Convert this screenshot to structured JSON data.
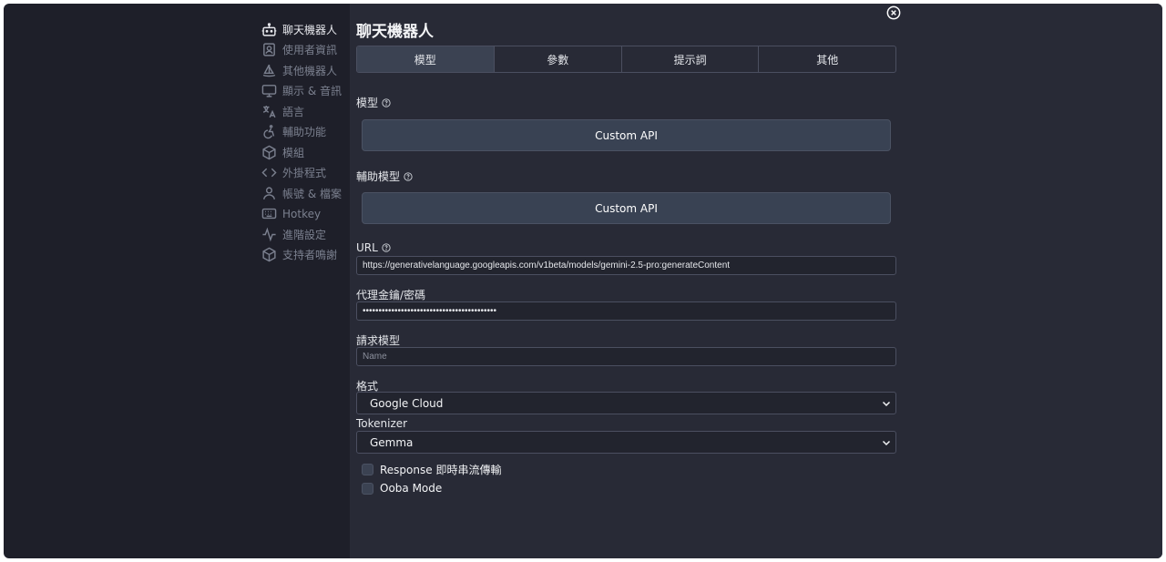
{
  "sidebar": {
    "items": [
      {
        "label": "聊天機器人",
        "icon": "bot-icon",
        "active": true
      },
      {
        "label": "使用者資訊",
        "icon": "user-card-icon"
      },
      {
        "label": "其他機器人",
        "icon": "sailboat-icon"
      },
      {
        "label": "顯示 & 音訊",
        "icon": "monitor-icon"
      },
      {
        "label": "語言",
        "icon": "translate-icon"
      },
      {
        "label": "輔助功能",
        "icon": "accessibility-icon"
      },
      {
        "label": "模組",
        "icon": "box-icon"
      },
      {
        "label": "外掛程式",
        "icon": "code-icon"
      },
      {
        "label": "帳號 & 檔案",
        "icon": "user-icon"
      },
      {
        "label": "Hotkey",
        "icon": "keyboard-icon"
      },
      {
        "label": "進階設定",
        "icon": "activity-icon"
      },
      {
        "label": "支持者鳴謝",
        "icon": "package-icon"
      }
    ]
  },
  "page": {
    "title": "聊天機器人"
  },
  "tabs": [
    "模型",
    "參數",
    "提示詞",
    "其他"
  ],
  "model": {
    "label": "模型",
    "value": "Custom API"
  },
  "aux_model": {
    "label": "輔助模型",
    "value": "Custom API"
  },
  "url": {
    "label": "URL",
    "value": "https://generativelanguage.googleapis.com/v1beta/models/gemini-2.5-pro:generateContent"
  },
  "proxy_key": {
    "label": "代理金鑰/密碼",
    "value": "••••••••••••••••••••••••••••••••••••••••••"
  },
  "request_model": {
    "label": "請求模型",
    "placeholder": "Name"
  },
  "format": {
    "label": "格式",
    "value": "Google Cloud"
  },
  "tokenizer": {
    "label": "Tokenizer",
    "value": "Gemma"
  },
  "options": {
    "streaming": {
      "label": "Response 即時串流傳輸",
      "checked": false
    },
    "ooba": {
      "label": "Ooba Mode",
      "checked": false
    }
  },
  "colors": {
    "background": "#1e1f29",
    "panel": "#282a36",
    "button": "#394253",
    "active_tab": "#3b4252"
  }
}
